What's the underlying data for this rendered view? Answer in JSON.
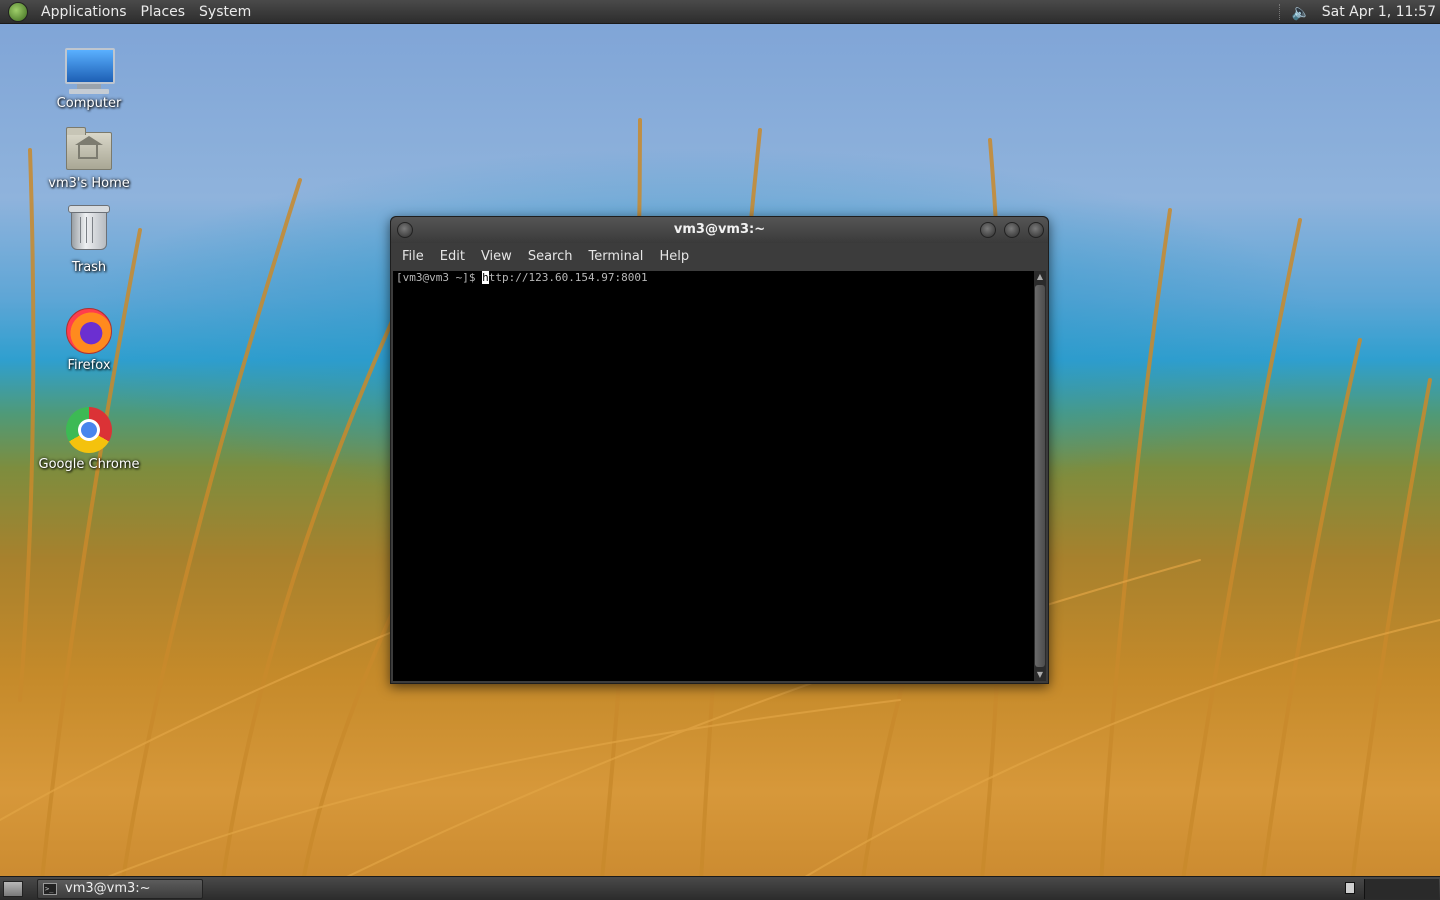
{
  "top_panel": {
    "menus": [
      "Applications",
      "Places",
      "System"
    ],
    "clock": "Sat Apr  1, 11:57"
  },
  "desktop_icons": [
    {
      "label": "Computer",
      "icon": "computer-icon"
    },
    {
      "label": "vm3's Home",
      "icon": "home-folder-icon"
    },
    {
      "label": "Trash",
      "icon": "trash-icon"
    },
    {
      "label": "Firefox",
      "icon": "firefox-icon"
    },
    {
      "label": "Google Chrome",
      "icon": "chrome-icon"
    }
  ],
  "terminal": {
    "title": "vm3@vm3:~",
    "menus": [
      "File",
      "Edit",
      "View",
      "Search",
      "Terminal",
      "Help"
    ],
    "prompt": "[vm3@vm3 ~]$ ",
    "input_first_char": "h",
    "input_rest": "ttp://123.60.154.97:8001"
  },
  "taskbar": {
    "window_label": "vm3@vm3:~"
  },
  "colors": {
    "panel": "#3a3a3a",
    "terminal_bg": "#000000",
    "terminal_text": "#b8b8b8"
  }
}
